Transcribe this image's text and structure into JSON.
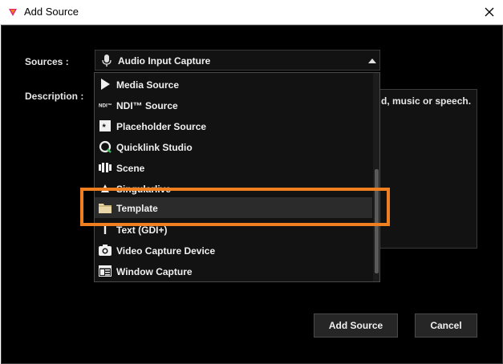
{
  "window": {
    "title": "Add Source"
  },
  "form": {
    "sources_label": "Sources :",
    "description_label": "Description :",
    "selected_source": "Audio Input Capture",
    "description_visible": "d, music or speech."
  },
  "dropdown": {
    "items": [
      {
        "label": "Media Source",
        "icon": "play-icon"
      },
      {
        "label": "NDI™ Source",
        "icon": "ndi-icon"
      },
      {
        "label": "Placeholder Source",
        "icon": "asterisk-icon"
      },
      {
        "label": "Quicklink Studio",
        "icon": "quicklink-icon"
      },
      {
        "label": "Scene",
        "icon": "scene-icon"
      },
      {
        "label": "Singularlive",
        "icon": "singularlive-icon"
      },
      {
        "label": "Template",
        "icon": "folder-icon"
      },
      {
        "label": "Text (GDI+)",
        "icon": "text-icon"
      },
      {
        "label": "Video Capture Device",
        "icon": "camera-icon"
      },
      {
        "label": "Window Capture",
        "icon": "window-icon"
      }
    ],
    "highlighted": "Template"
  },
  "buttons": {
    "add": "Add Source",
    "cancel": "Cancel"
  },
  "colors": {
    "background": "#000000",
    "highlight": "#f07f1f",
    "text": "#f0f0f0"
  }
}
